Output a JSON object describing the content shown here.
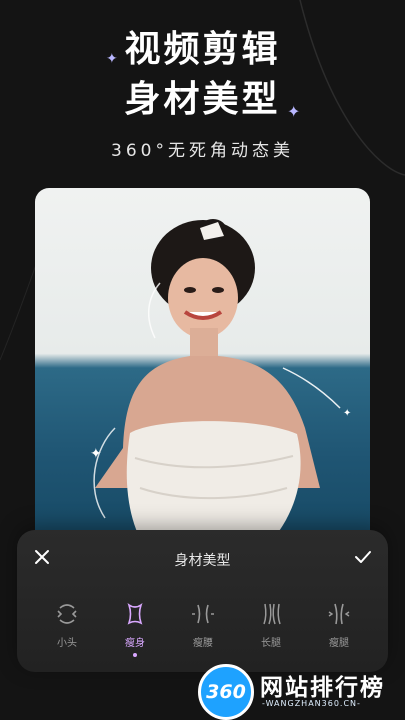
{
  "headline": {
    "line1": "视频剪辑",
    "line2": "身材美型",
    "subline": "360°无死角动态美"
  },
  "panel": {
    "title": "身材美型",
    "tools": [
      {
        "label": "小头",
        "icon": "small-head-icon",
        "active": false
      },
      {
        "label": "瘦身",
        "icon": "slim-body-icon",
        "active": true
      },
      {
        "label": "瘦腰",
        "icon": "slim-waist-icon",
        "active": false
      },
      {
        "label": "长腿",
        "icon": "long-legs-icon",
        "active": false
      },
      {
        "label": "瘦腿",
        "icon": "slim-legs-icon",
        "active": false
      }
    ]
  },
  "watermark": {
    "logo": "360",
    "name": "网站排行榜",
    "domain": "-WANGZHAN360.CN-"
  },
  "colors": {
    "background": "#141414",
    "accent": "#d9a8ff",
    "sparkle": "#b9b7ff",
    "watermark_blue": "#1ea2ff"
  }
}
